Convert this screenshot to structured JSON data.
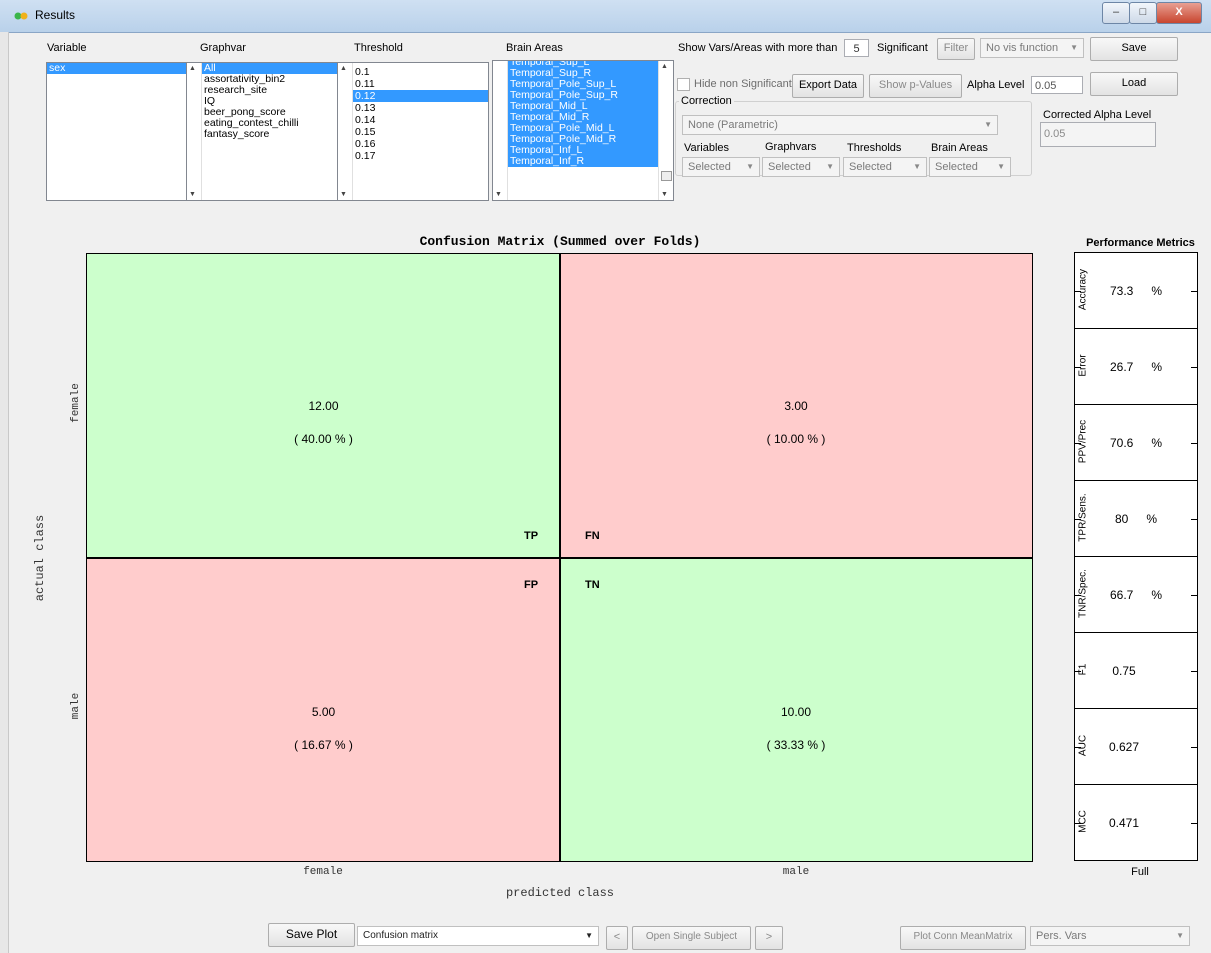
{
  "window": {
    "title": "Results",
    "minimize": "–",
    "maximize": "□",
    "close": "X"
  },
  "top": {
    "variable": {
      "label": "Variable",
      "items": [
        "sex"
      ],
      "selected": "sex"
    },
    "graphvar": {
      "label": "Graphvar",
      "items": [
        "All",
        "assortativity_bin2",
        "research_site",
        "IQ",
        "beer_pong_score",
        "eating_contest_chilli",
        "fantasy_score"
      ],
      "selected": "All"
    },
    "threshold": {
      "label": "Threshold",
      "items": [
        "0.1",
        "0.11",
        "0.12",
        "0.13",
        "0.14",
        "0.15",
        "0.16",
        "0.17"
      ],
      "selected": "0.12"
    },
    "brain_areas": {
      "label": "Brain Areas",
      "items": [
        "Temporal_Sup_L",
        "Temporal_Sup_R",
        "Temporal_Pole_Sup_L",
        "Temporal_Pole_Sup_R",
        "Temporal_Mid_L",
        "Temporal_Mid_R",
        "Temporal_Pole_Mid_L",
        "Temporal_Pole_Mid_R",
        "Temporal_Inf_L",
        "Temporal_Inf_R"
      ]
    },
    "show_vars_label": "Show Vars/Areas with more than",
    "show_vars_value": "5",
    "significant_label": "Significant",
    "filter_btn": "Filter",
    "vis_function": "No vis function",
    "save_btn": "Save",
    "load_btn": "Load",
    "hide_nonsig_label": "Hide non Significant",
    "export_btn": "Export Data",
    "show_p_btn": "Show p-Values",
    "alpha_label": "Alpha Level",
    "alpha_value": "0.05",
    "correction": {
      "label": "Correction",
      "method": "None  (Parametric)",
      "variables_label": "Variables",
      "graphvars_label": "Graphvars",
      "thresholds_label": "Thresholds",
      "brain_areas_label": "Brain Areas",
      "variables_value": "Selected",
      "graphvars_value": "Selected",
      "thresholds_value": "Selected",
      "brain_areas_value": "Selected"
    },
    "corrected_alpha_label": "Corrected Alpha Level",
    "corrected_alpha_value": "0.05"
  },
  "matrix": {
    "title": "Confusion Matrix (Summed over Folds)",
    "ylabel": "actual class",
    "xlabel": "predicted class",
    "row_labels": [
      "female",
      "male"
    ],
    "col_labels": [
      "female",
      "male"
    ],
    "cells": {
      "tp": {
        "value": "12.00",
        "pct": "( 40.00  % )",
        "tag": "TP"
      },
      "fn": {
        "value": "3.00",
        "pct": "( 10.00  % )",
        "tag": "FN"
      },
      "fp": {
        "value": "5.00",
        "pct": "( 16.67  % )",
        "tag": "FP"
      },
      "tn": {
        "value": "10.00",
        "pct": "( 33.33  % )",
        "tag": "TN"
      }
    },
    "colors": {
      "correct": "#ccffcc",
      "wrong": "#ffcccc"
    }
  },
  "metrics": {
    "title": "Performance Metrics",
    "xlabel": "Full",
    "rows": [
      {
        "label": "Accuracy",
        "value": "73.3",
        "unit": "%"
      },
      {
        "label": "Error",
        "value": "26.7",
        "unit": "%"
      },
      {
        "label": "PPV/Prec",
        "value": "70.6",
        "unit": "%"
      },
      {
        "label": "TPR/Sens.",
        "value": "80",
        "unit": "%"
      },
      {
        "label": "TNR/Spec.",
        "value": "66.7",
        "unit": "%"
      },
      {
        "label": "F1",
        "value": "0.75",
        "unit": ""
      },
      {
        "label": "AUC",
        "value": "0.627",
        "unit": ""
      },
      {
        "label": "MCC",
        "value": "0.471",
        "unit": ""
      }
    ]
  },
  "bottom": {
    "save_plot": "Save Plot",
    "plot_type": "Confusion matrix",
    "prev": "<",
    "open_single": "Open Single Subject",
    "next": ">",
    "plot_conn": "Plot Conn MeanMatrix",
    "pers_vars": "Pers. Vars"
  }
}
